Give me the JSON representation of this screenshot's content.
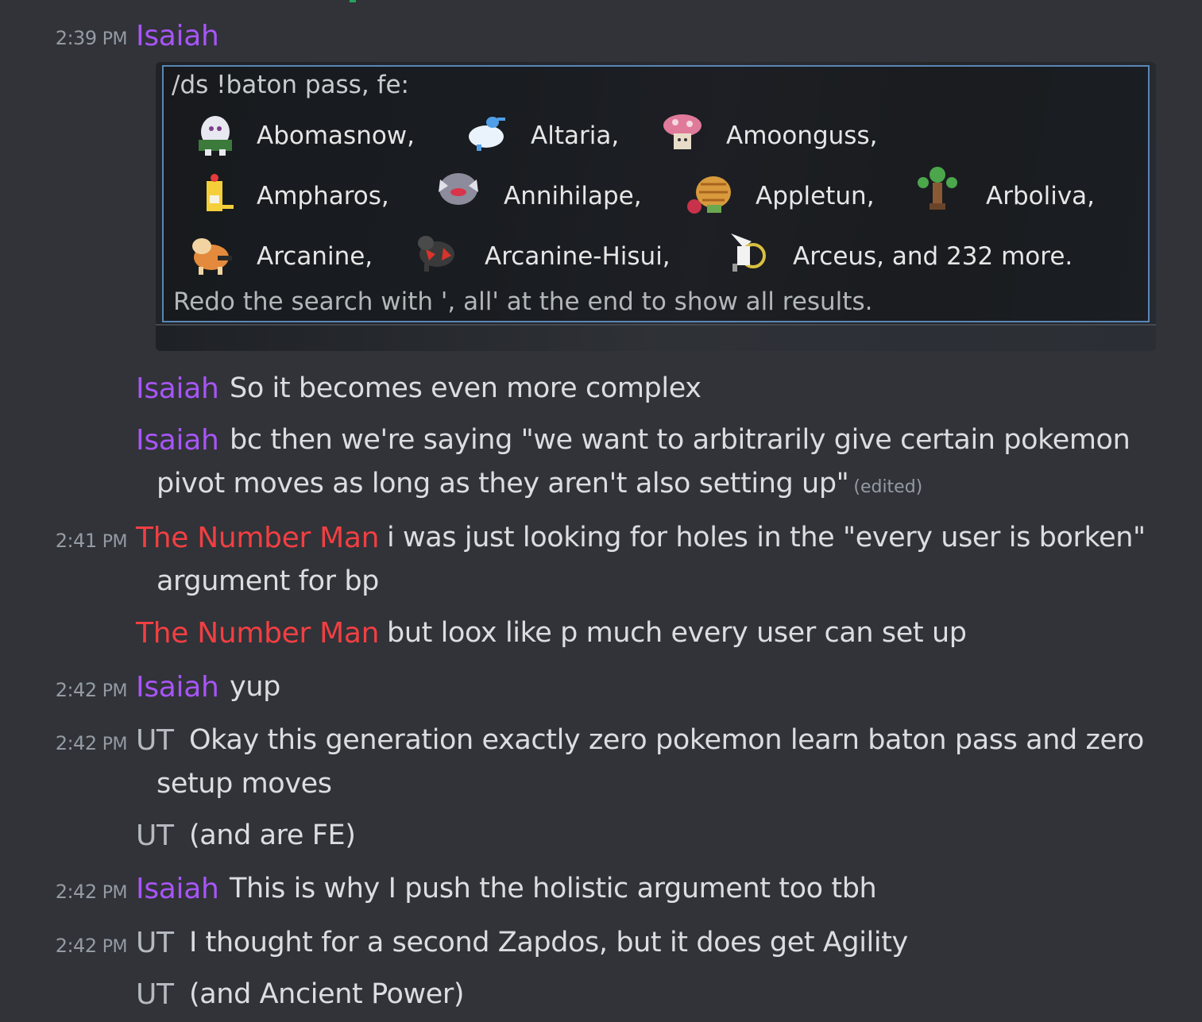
{
  "messages": [
    {
      "timestamp": "2:39",
      "ampm": "PM",
      "author": "Isaiah",
      "author_color": "#a855f7"
    },
    {
      "author": "Isaiah",
      "text": "So it becomes even more complex"
    },
    {
      "author": "Isaiah",
      "text_line1": "bc then we're saying \"we want to arbitrarily give certain pokemon",
      "text_line2": "pivot moves as long as they aren't also setting up\"",
      "edited": "(edited)"
    },
    {
      "timestamp": "2:41",
      "ampm": "PM",
      "author": "The Number Man",
      "author_color": "#f23f42",
      "text_line1": "i was just looking for holes in the \"every user is borken\"",
      "text_line2": "argument for bp"
    },
    {
      "author": "The Number Man",
      "text": "but loox like p much every user can set up"
    },
    {
      "timestamp": "2:42",
      "ampm": "PM",
      "author": "Isaiah",
      "text": "yup"
    },
    {
      "timestamp": "2:42",
      "ampm": "PM",
      "author": "UT",
      "author_color": "#b5bac1",
      "text_line1": "Okay this generation exactly zero pokemon learn baton pass and zero",
      "text_line2": "setup moves"
    },
    {
      "author": "UT",
      "text": "(and are FE)"
    },
    {
      "timestamp": "2:42",
      "ampm": "PM",
      "author": "Isaiah",
      "text": "This is why I push the holistic argument too tbh"
    },
    {
      "timestamp": "2:42",
      "ampm": "PM",
      "author": "UT",
      "text": "I thought for a second Zapdos, but it does get Agility"
    },
    {
      "author": "UT",
      "text": "(and Ancient Power)"
    }
  ],
  "attachment": {
    "command": "/ds !baton pass, fe:",
    "results": [
      {
        "name": "Abomasnow,",
        "sprite_icon": "abomasnow-icon"
      },
      {
        "name": "Altaria,",
        "sprite_icon": "altaria-icon"
      },
      {
        "name": "Amoonguss,",
        "sprite_icon": "amoonguss-icon"
      },
      {
        "name": "Ampharos,",
        "sprite_icon": "ampharos-icon"
      },
      {
        "name": "Annihilape,",
        "sprite_icon": "annihilape-icon"
      },
      {
        "name": "Appletun,",
        "sprite_icon": "appletun-icon"
      },
      {
        "name": "Arboliva,",
        "sprite_icon": "arboliva-icon"
      },
      {
        "name": "Arcanine,",
        "sprite_icon": "arcanine-icon"
      },
      {
        "name": "Arcanine-Hisui,",
        "sprite_icon": "arcanine-hisui-icon"
      },
      {
        "name": "Arceus, and 232 more.",
        "sprite_icon": "arceus-icon"
      }
    ],
    "hint": "Redo the search with ', all' at the end to show all results."
  },
  "colors": {
    "background": "#313338",
    "isaiah": "#a855f7",
    "number_man": "#f23f42",
    "ut": "#b5bac1",
    "timestamp": "#949ba4",
    "message_text": "#dbdee1",
    "panel_border": "#5a86b6"
  }
}
